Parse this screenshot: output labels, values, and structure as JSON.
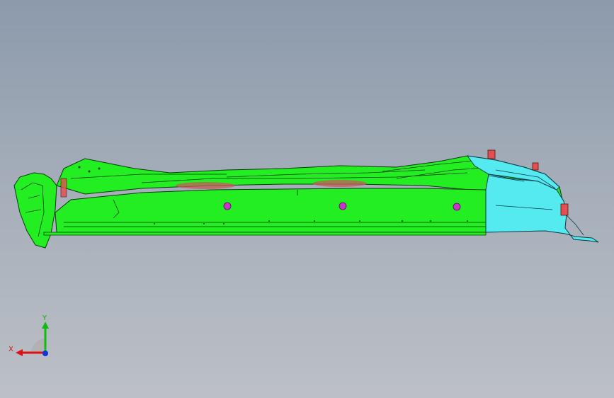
{
  "viewport": {
    "background_top": "#8c9aac",
    "background_bottom": "#bcc0c6",
    "model": {
      "main_part_color": "#22ee22",
      "secondary_part_color": "#55eaf0",
      "hole_color": "#cc33cc",
      "clip_color": "#e05050"
    }
  },
  "triad": {
    "x_label": "X",
    "y_label": "Y",
    "x_color": "#dd1111",
    "y_color": "#11bb11",
    "z_color": "#1133dd"
  }
}
